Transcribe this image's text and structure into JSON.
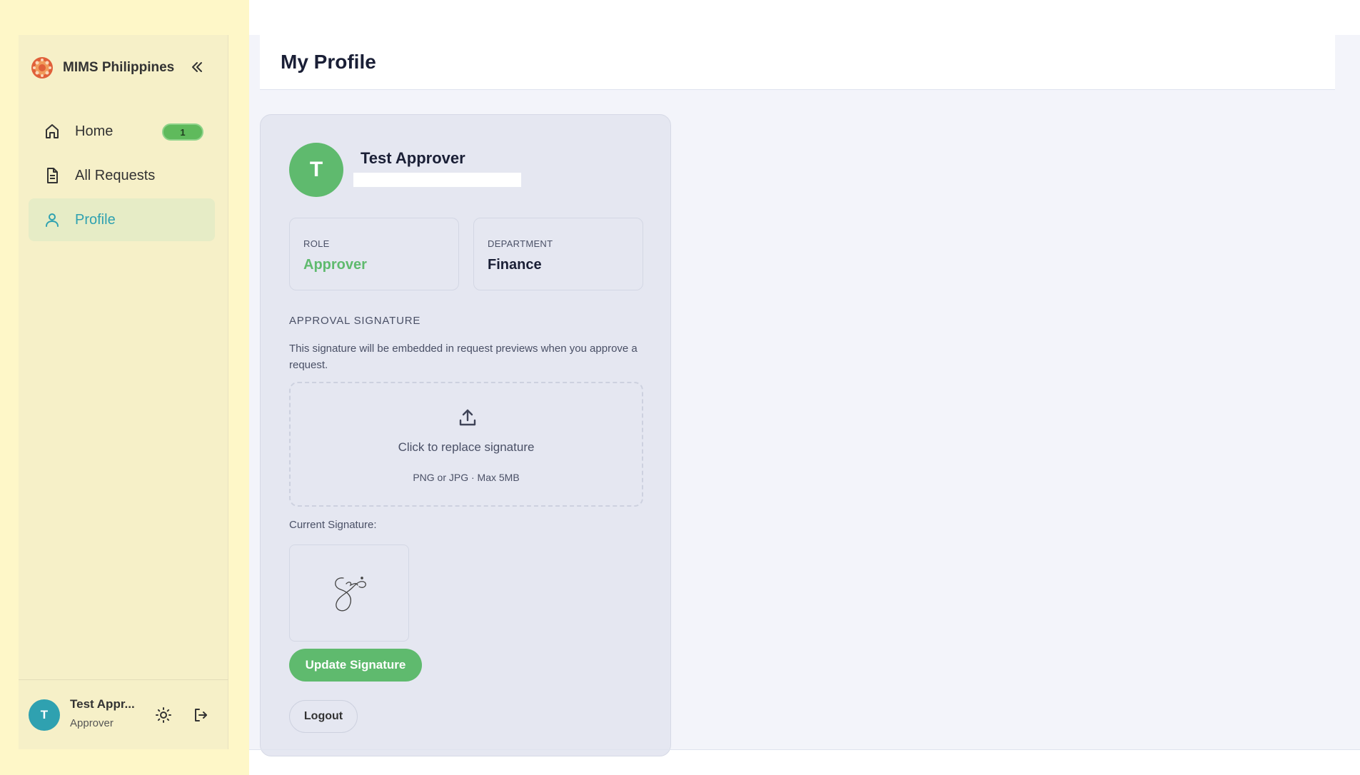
{
  "app": {
    "brand_name": "MIMS Philippines"
  },
  "sidebar": {
    "items": [
      {
        "label": "Home",
        "icon": "home-icon",
        "badge": "1"
      },
      {
        "label": "All Requests",
        "icon": "document-icon"
      },
      {
        "label": "Profile",
        "icon": "user-icon",
        "active": true
      }
    ],
    "user": {
      "initial": "T",
      "name": "Test Appr...",
      "role": "Approver"
    }
  },
  "page": {
    "title": "My Profile"
  },
  "profile": {
    "initial": "T",
    "name": "Test Approver",
    "role_label": "ROLE",
    "role_value": "Approver",
    "department_label": "DEPARTMENT",
    "department_value": "Finance",
    "signature_heading": "APPROVAL SIGNATURE",
    "signature_description": "This signature will be embedded in request previews when you approve a request.",
    "upload_title": "Click to replace signature",
    "upload_hint": "PNG or JPG · Max 5MB",
    "current_signature_label": "Current Signature:",
    "update_button": "Update Signature",
    "logout_button": "Logout"
  },
  "colors": {
    "accent_green": "#5fba6e",
    "accent_teal": "#2fa1b0",
    "sidebar_bg": "#fef7c8"
  }
}
